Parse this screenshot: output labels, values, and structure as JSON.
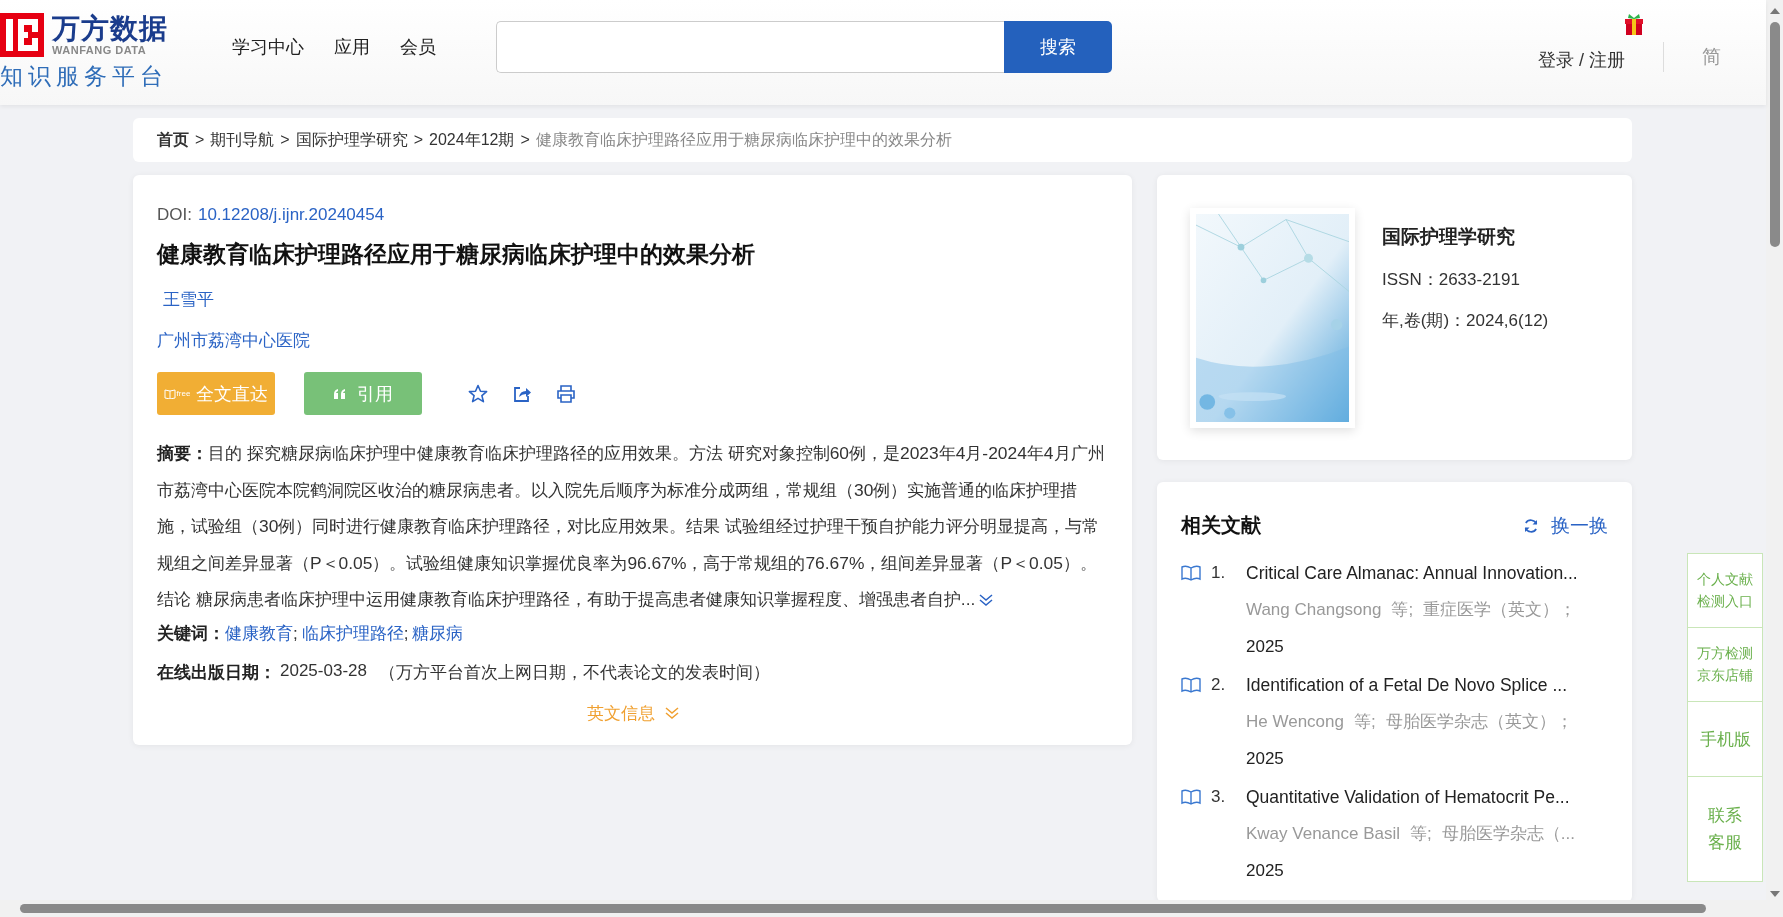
{
  "header": {
    "logo": {
      "name": "万方数据",
      "name_en": "WANFANG DATA",
      "tagline": "知识服务平台"
    },
    "nav": [
      "学习中心",
      "应用",
      "会员"
    ],
    "search": {
      "button": "搜索"
    },
    "login": "登录 / 注册",
    "languages": [
      "简"
    ]
  },
  "breadcrumb": [
    {
      "kind": "home",
      "label": "首页"
    },
    {
      "kind": "link",
      "separator": ">",
      "label": "期刊导航"
    },
    {
      "kind": "link",
      "separator": ">",
      "label": "国际护理学研究"
    },
    {
      "kind": "link",
      "separator": ">",
      "label": "2024年12期"
    },
    {
      "kind": "current",
      "separator": ">",
      "label": "健康教育临床护理路径应用于糖尿病临床护理中的效果分析"
    }
  ],
  "article": {
    "doi_label": "DOI:",
    "doi": "10.12208/j.ijnr.20240454",
    "title": "健康教育临床护理路径应用于糖尿病临床护理中的效果分析",
    "authors": [
      "王雪平"
    ],
    "affiliations": [
      "广州市荔湾中心医院"
    ],
    "fulltext_button": {
      "badge": "free",
      "label": "全文直达"
    },
    "cite_button": {
      "label": "引用"
    },
    "abstract_label": "摘要：",
    "abstract": "目的 探究糖尿病临床护理中健康教育临床护理路径的应用效果。方法 研究对象控制60例，是2023年4月-2024年4月广州市荔湾中心医院本院鹤洞院区收治的糖尿病患者。以入院先后顺序为标准分成两组，常规组（30例）实施普通的临床护理措施，试验组（30例）同时进行健康教育临床护理路径，对比应用效果。结果 试验组经过护理干预自护能力评分明显提高，与常规组之间差异显著（P＜0.05）。试验组健康知识掌握优良率为96.67%，高于常规组的76.67%，组间差异显著（P＜0.05）。结论 糖尿病患者临床护理中运用健康教育临床护理路径，有助于提高患者健康知识掌握程度、增强患者自护...",
    "keywords_label": "关键词：",
    "keywords": [
      {
        "label": "健康教育",
        "separator": ";"
      },
      {
        "label": "临床护理路径",
        "separator": ";"
      },
      {
        "label": "糖尿病"
      }
    ],
    "date_label": "在线出版日期：",
    "date": "2025-03-28",
    "date_note": "（万方平台首次上网日期，不代表论文的发表时间）",
    "english_toggle": "英文信息"
  },
  "journal": {
    "name": "国际护理学研究",
    "issn": "ISSN：2633-2191",
    "volume": "年,卷(期)：2024,6(12)"
  },
  "related": {
    "title": "相关文献",
    "refresh": "换一换",
    "items": [
      {
        "number": "1.",
        "title": "Critical Care Almanac: Annual Innovation...",
        "authors": "Wang Changsong",
        "et_al": "等;",
        "source": "重症医学（英文）；",
        "year": "2025"
      },
      {
        "number": "2.",
        "title": "Identification of a Fetal De Novo Splice ...",
        "authors": "He Wencong",
        "et_al": "等;",
        "source": "母胎医学杂志（英文）；",
        "year": "2025"
      },
      {
        "number": "3.",
        "title": "Quantitative Validation of Hematocrit Pe...",
        "authors": "Kway Venance Basil",
        "et_al": "等;",
        "source": "母胎医学杂志（...",
        "year": "2025"
      }
    ]
  },
  "side_panel": [
    {
      "kind": "small",
      "label": "个人文献检测入口"
    },
    {
      "kind": "small",
      "label": "万方检测京东店铺"
    },
    {
      "kind": "large",
      "label": "手机版"
    },
    {
      "kind": "large",
      "label": "联系客服"
    }
  ]
}
